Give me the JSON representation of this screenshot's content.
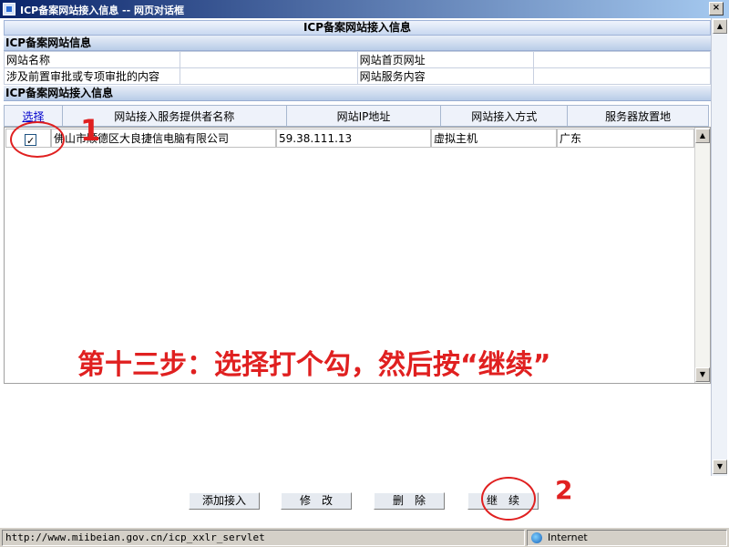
{
  "window": {
    "title": "ICP备案网站接入信息  -- 网页对话框",
    "close_label": "×"
  },
  "main_header": "ICP备案网站接入信息",
  "site_info": {
    "header": "ICP备案网站信息",
    "site_name_label": "网站名称",
    "homepage_label": "网站首页网址",
    "approval_label": "涉及前置审批或专项审批的内容",
    "service_label": "网站服务内容"
  },
  "access_info": {
    "header": "ICP备案网站接入信息",
    "columns": {
      "select": "选择",
      "provider": "网站接入服务提供者名称",
      "ip": "网站IP地址",
      "method": "网站接入方式",
      "location": "服务器放置地"
    },
    "rows": [
      {
        "checked": true,
        "provider": "佛山市顺德区大良捷信电脑有限公司",
        "ip": "59.38.111.13",
        "method": "虚拟主机",
        "location": "广东"
      }
    ]
  },
  "annotations": {
    "instruction": "第十三步：选择打个勾，然后按“继续”",
    "step1": "1",
    "step2": "2"
  },
  "buttons": {
    "add": "添加接入",
    "modify": "修　改",
    "delete": "删　除",
    "continue": "继　续"
  },
  "status": {
    "url": "http://www.miibeian.gov.cn/icp_xxlr_servlet",
    "zone": "Internet"
  },
  "colors": {
    "annotation_red": "#e02020",
    "title_bar": "#0a246a"
  }
}
